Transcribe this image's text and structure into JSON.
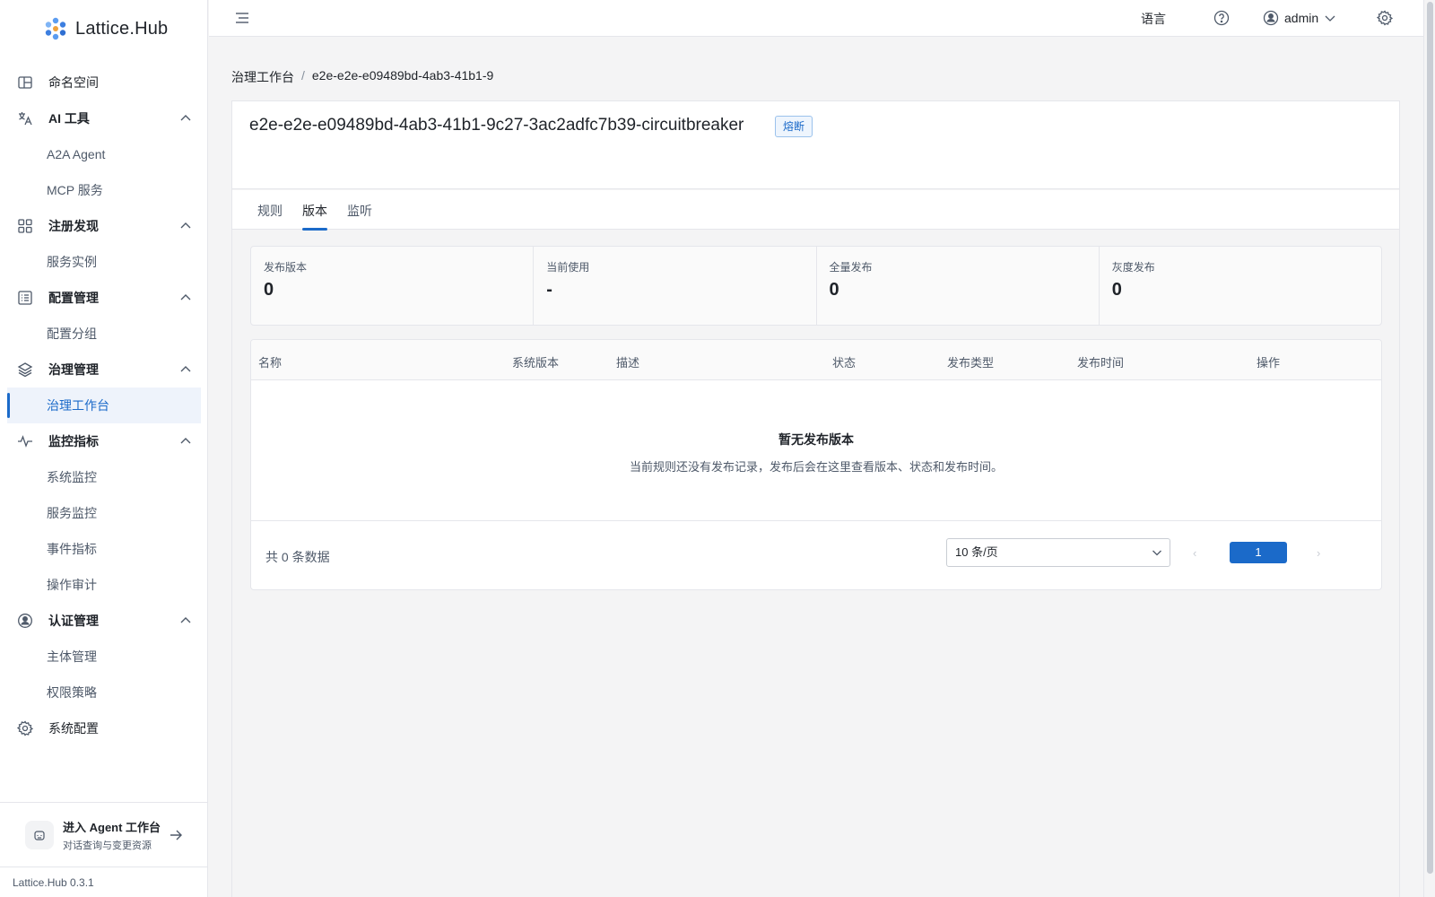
{
  "brand": {
    "name": "Lattice.Hub",
    "version": "Lattice.Hub 0.3.1"
  },
  "sidebar": {
    "items": [
      {
        "label": "命名空间",
        "icon": "namespace-icon",
        "type": "item"
      },
      {
        "label": "AI 工具",
        "icon": "translate-icon",
        "type": "group",
        "children": [
          "A2A Agent",
          "MCP 服务"
        ]
      },
      {
        "label": "注册发现",
        "icon": "grid-icon",
        "type": "group",
        "children": [
          "服务实例"
        ]
      },
      {
        "label": "配置管理",
        "icon": "list-icon",
        "type": "group",
        "children": [
          "配置分组"
        ]
      },
      {
        "label": "治理管理",
        "icon": "layers-icon",
        "type": "group",
        "children": [
          "治理工作台"
        ]
      },
      {
        "label": "监控指标",
        "icon": "pulse-icon",
        "type": "group",
        "children": [
          "系统监控",
          "服务监控",
          "事件指标",
          "操作审计"
        ]
      },
      {
        "label": "认证管理",
        "icon": "user-circle-icon",
        "type": "group",
        "children": [
          "主体管理",
          "权限策略"
        ]
      },
      {
        "label": "系统配置",
        "icon": "gear-icon",
        "type": "item"
      }
    ],
    "active": "治理工作台",
    "agent_entry": {
      "title": "进入 Agent 工作台",
      "subtitle": "对话查询与变更资源"
    }
  },
  "topbar": {
    "language": "语言",
    "user": "admin"
  },
  "breadcrumb": {
    "root": "治理工作台",
    "separator": "/",
    "current": "e2e-e2e-e09489bd-4ab3-41b1-9"
  },
  "rule": {
    "title": "e2e-e2e-e09489bd-4ab3-41b1-9c27-3ac2adfc7b39-circuitbreaker",
    "badge": "熔断"
  },
  "tabs": [
    {
      "label": "规则",
      "active": false
    },
    {
      "label": "版本",
      "active": true
    },
    {
      "label": "监听",
      "active": false
    }
  ],
  "stats": [
    {
      "label": "发布版本",
      "value": "0"
    },
    {
      "label": "当前使用",
      "value": "-"
    },
    {
      "label": "全量发布",
      "value": "0"
    },
    {
      "label": "灰度发布",
      "value": "0"
    }
  ],
  "table": {
    "columns": [
      "名称",
      "系统版本",
      "描述",
      "状态",
      "发布类型",
      "发布时间",
      "操作"
    ],
    "rows": [],
    "empty_title": "暂无发布版本",
    "empty_desc": "当前规则还没有发布记录，发布后会在这里查看版本、状态和发布时间。"
  },
  "pagination": {
    "total_text": "共 0 条数据",
    "page_size": "10 条/页",
    "current_page": "1",
    "prev": "‹",
    "next": "›"
  },
  "colors": {
    "accent": "#1b6ac9",
    "active_bg": "#eef3fb"
  }
}
